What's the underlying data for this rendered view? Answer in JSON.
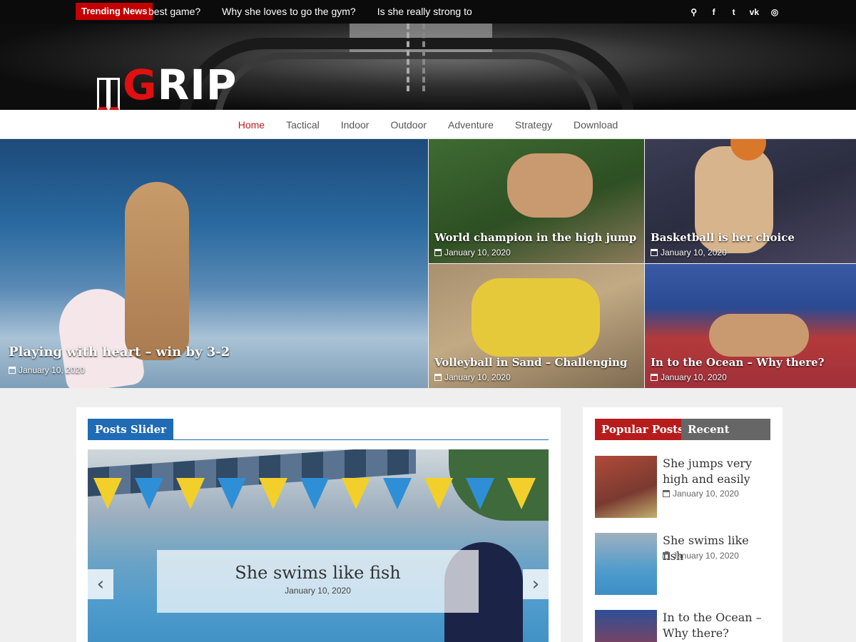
{
  "topbar": {
    "badge": "Trending News",
    "ticker": [
      "best game?",
      "Why she loves to go the gym?",
      "Is she really strong to"
    ],
    "social_icons": [
      "search-icon",
      "facebook-icon",
      "twitter-icon",
      "vk-icon",
      "instagram-icon"
    ],
    "social_glyphs": {
      "search": "⚲",
      "facebook": "f",
      "twitter": "t",
      "vk": "vk",
      "instagram": "◎"
    }
  },
  "header": {
    "logo_text_g": "G",
    "logo_text_rest": "RIP"
  },
  "nav": {
    "items": [
      "Home",
      "Tactical",
      "Indoor",
      "Outdoor",
      "Adventure",
      "Strategy",
      "Download"
    ],
    "active": "Home"
  },
  "hero": {
    "big": {
      "title": "Playing with heart – win by 3-2",
      "date": "January 10, 2020"
    },
    "tiles": [
      {
        "title": "World champion in the high jump",
        "date": "January 10, 2020"
      },
      {
        "title": "Basketball is her choice",
        "date": "January 10, 2020"
      },
      {
        "title": "Volleyball in Sand – Challenging",
        "date": "January 10, 2020"
      },
      {
        "title": "In to the Ocean – Why there?",
        "date": "January 10, 2020"
      }
    ]
  },
  "main": {
    "section_title": "Posts Slider",
    "slide": {
      "title": "She swims like fish",
      "date": "January 10, 2020"
    },
    "arrow_left": "‹",
    "arrow_right": "›"
  },
  "sidebar": {
    "tabs": {
      "popular": "Popular Posts",
      "recent": "Recent Posts"
    },
    "posts": [
      {
        "title": "She jumps very high and easily",
        "date": "January 10, 2020"
      },
      {
        "title": "She swims like fish",
        "date": "January 10, 2020"
      },
      {
        "title": "In to the Ocean – Why there?",
        "date": ""
      }
    ]
  },
  "colors": {
    "accent_red": "#b71c1c",
    "accent_blue": "#1f6bb5",
    "topbar": "#0b0b0b"
  }
}
